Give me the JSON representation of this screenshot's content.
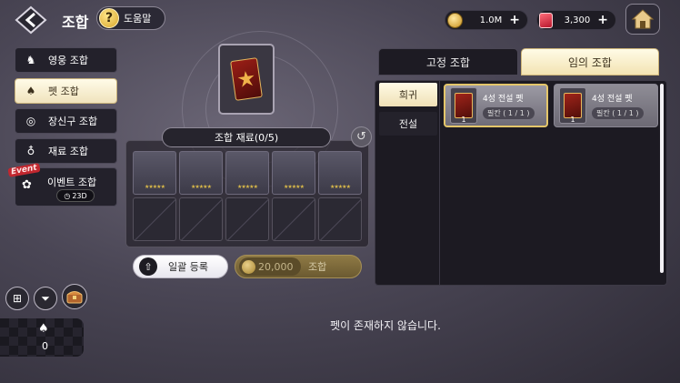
{
  "header": {
    "title": "조합",
    "help_label": "도움말",
    "gold": "1.0M",
    "gems": "3,300"
  },
  "menu": {
    "items": [
      {
        "label": "영웅 조합",
        "icon": "hero-icon",
        "active": false
      },
      {
        "label": "펫 조합",
        "icon": "pet-icon",
        "active": true
      },
      {
        "label": "장신구 조합",
        "icon": "ring-icon",
        "active": false
      },
      {
        "label": "재료 조합",
        "icon": "material-icon",
        "active": false
      }
    ],
    "event": {
      "tag": "Event",
      "label": "이벤트 조합",
      "timer": "23D"
    }
  },
  "center": {
    "materials_header": "조합 재료(0/5)",
    "bulk_label": "일괄 등록",
    "cost": "20,000",
    "combine_label": "조합",
    "stars": "★★★★★"
  },
  "right": {
    "tabs": [
      {
        "label": "고정 조합",
        "active": false
      },
      {
        "label": "임의 조합",
        "active": true
      }
    ],
    "side_tabs": [
      {
        "label": "희귀",
        "active": true
      },
      {
        "label": "전설",
        "active": false
      }
    ],
    "results": [
      {
        "name": "4성 전설 펫",
        "qty": "필칸 ( 1 / 1 )",
        "count": "1",
        "selected": true
      },
      {
        "name": "4성 전설 펫",
        "qty": "필칸 ( 1 / 1 )",
        "count": "1",
        "selected": false
      }
    ]
  },
  "bottom": {
    "pet_count": "0",
    "empty_message": "펫이 존재하지 않습니다."
  },
  "colors": {
    "accent_gold": "#e4c66a",
    "active_tab": "#f3e3b3",
    "panel_dark": "#1c1a22"
  }
}
